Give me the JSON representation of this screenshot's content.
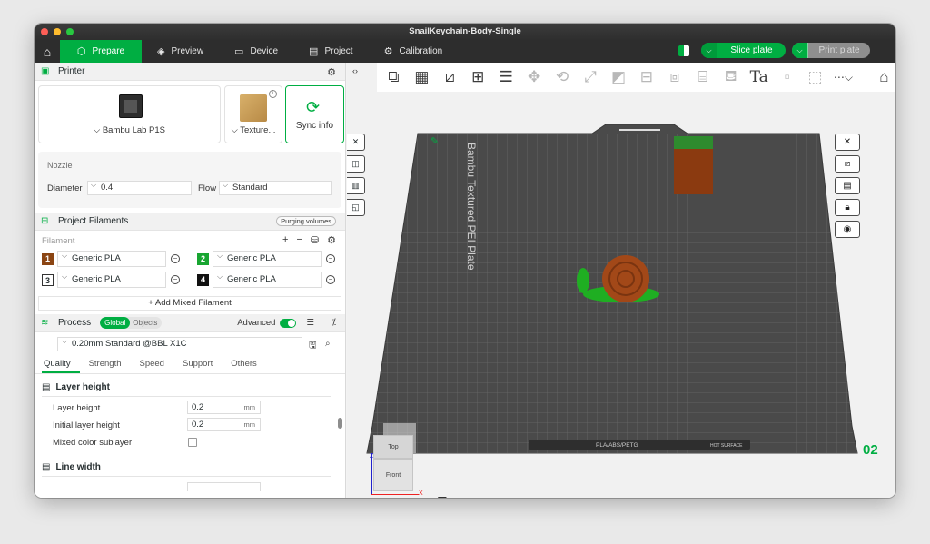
{
  "window": {
    "title": "SnailKeychain-Body-Single"
  },
  "tabs": [
    {
      "label": "Prepare",
      "icon": "cube-icon"
    },
    {
      "label": "Preview",
      "icon": "layers-icon"
    },
    {
      "label": "Device",
      "icon": "device-icon"
    },
    {
      "label": "Project",
      "icon": "project-icon"
    },
    {
      "label": "Calibration",
      "icon": "gear-icon"
    }
  ],
  "actions": {
    "slice_label": "Slice plate",
    "print_label": "Print plate"
  },
  "printer": {
    "section_title": "Printer",
    "printer_name": "Bambu Lab P1S",
    "plate_name": "Texture...",
    "sync_label": "Sync info",
    "nozzle_title": "Nozzle",
    "diameter_label": "Diameter",
    "diameter_value": "0.4",
    "flow_label": "Flow",
    "flow_value": "Standard"
  },
  "filaments": {
    "section_title": "Project Filaments",
    "purge_label": "Purging volumes",
    "sub_label": "Filament",
    "slots": [
      {
        "num": "1",
        "name": "Generic PLA",
        "color": "#8b4513",
        "text_color": "#ffffff"
      },
      {
        "num": "2",
        "name": "Generic PLA",
        "color": "#18a531",
        "text_color": "#ffffff"
      },
      {
        "num": "3",
        "name": "Generic PLA",
        "color": "#ffffff",
        "text_color": "#262e30"
      },
      {
        "num": "4",
        "name": "Generic PLA",
        "color": "#111111",
        "text_color": "#ffffff"
      }
    ],
    "mixed_label": "Add Mixed Filament"
  },
  "process": {
    "section_title": "Process",
    "global_label": "Global",
    "objects_label": "Objects",
    "advanced_label": "Advanced",
    "preset": "0.20mm Standard @BBL X1C",
    "tabs": [
      "Quality",
      "Strength",
      "Speed",
      "Support",
      "Others"
    ],
    "layer_group": "Layer height",
    "layer_height_label": "Layer height",
    "layer_height_value": "0.2",
    "initial_layer_label": "Initial layer height",
    "initial_layer_value": "0.2",
    "unit": "mm",
    "sublayer_label": "Mixed color sublayer",
    "line_group": "Line width"
  },
  "viewport": {
    "plate_text": "Bambu Textured PEI Plate",
    "plate_number": "02",
    "filament_types": "PLA/ABS/PETG",
    "hot_surface": "HOT SURFACE",
    "cube_top": "Top",
    "cube_front": "Front",
    "axis_z": "Z",
    "axis_x": "X"
  }
}
